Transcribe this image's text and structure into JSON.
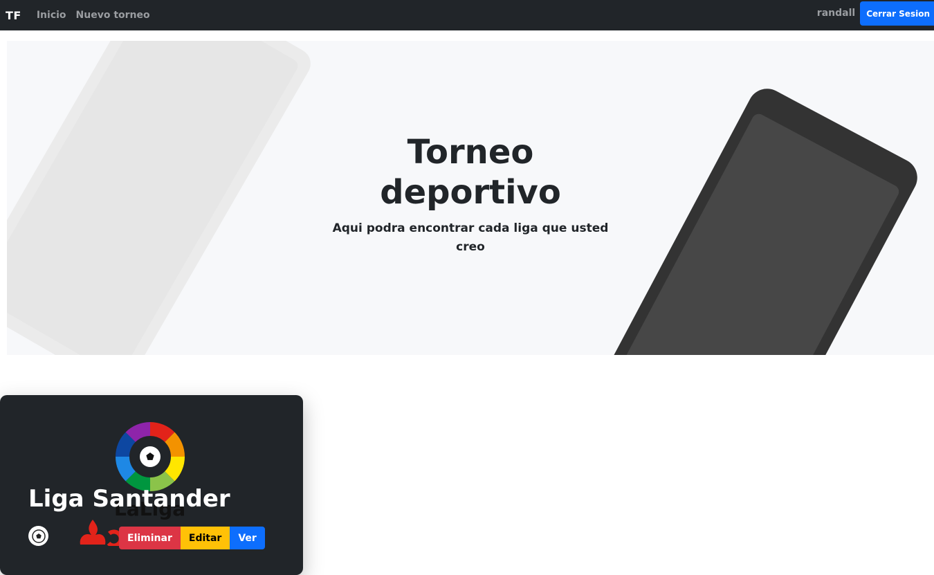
{
  "navbar": {
    "brand": "TF",
    "links": [
      "Inicio",
      "Nuevo torneo"
    ],
    "user": "randall",
    "logout_label": "Cerrar Sesion"
  },
  "hero": {
    "title": "Torneo deportivo",
    "subtitle": "Aqui podra encontrar cada liga que usted creo"
  },
  "card": {
    "title": "Liga Santander",
    "logo_text": "LaLiga",
    "buttons": {
      "delete": "Eliminar",
      "edit": "Editar",
      "view": "Ver"
    }
  },
  "colors": {
    "navbar_bg": "#212529",
    "primary": "#0d6efd",
    "danger": "#dc3545",
    "warning": "#ffc107"
  }
}
